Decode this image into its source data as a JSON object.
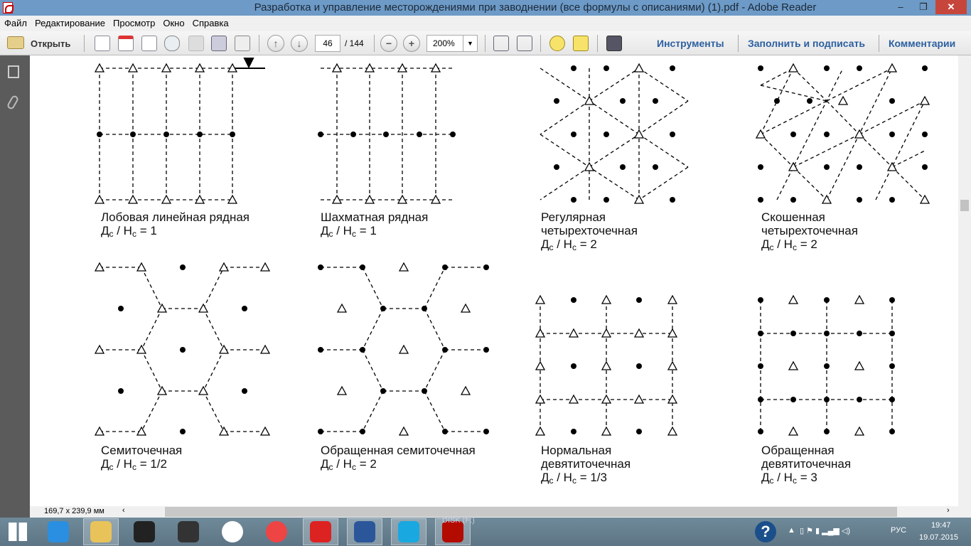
{
  "window": {
    "title": "Разработка и управление месторождениями при заводнении (все формулы с описаниями) (1).pdf - Adobe Reader",
    "minimize": "–",
    "restore": "❐",
    "close": "✕"
  },
  "menu": [
    "Файл",
    "Редактирование",
    "Просмотр",
    "Окно",
    "Справка"
  ],
  "toolbar": {
    "open": "Открыть",
    "page": "46",
    "page_total": "/ 144",
    "zoom": "200%",
    "tools": "Инструменты",
    "fill_sign": "Заполнить и подписать",
    "comments": "Комментарии"
  },
  "status": {
    "dimensions": "169,7 x 239,9 мм"
  },
  "diagrams": [
    {
      "name": "Лобовая линейная рядная",
      "lines": [],
      "f": {
        "a": "Д",
        "s1": "с",
        "b": " / Н",
        "s2": "с",
        "c": " = 1"
      }
    },
    {
      "name": "Шахматная рядная",
      "lines": [],
      "f": {
        "a": "Д",
        "s1": "с",
        "b": " / Н",
        "s2": "с",
        "c": " = 1"
      }
    },
    {
      "name": "Регулярная",
      "lines": [
        "четырехточечная"
      ],
      "f": {
        "a": "Д",
        "s1": "с",
        "b": " / Н",
        "s2": "с",
        "c": " = 2"
      }
    },
    {
      "name": "Скошенная",
      "lines": [
        "четырехточечная"
      ],
      "f": {
        "a": "Д",
        "s1": "с",
        "b": " / Н",
        "s2": "с",
        "c": " = 2"
      }
    },
    {
      "name": "Семиточечная",
      "lines": [],
      "f": {
        "a": "Д",
        "s1": "с",
        "b": " / Н",
        "s2": "с",
        "c": " = 1/2"
      }
    },
    {
      "name": "Обращенная семиточечная",
      "lines": [],
      "f": {
        "a": "Д",
        "s1": "с",
        "b": " / Н",
        "s2": "с",
        "c": " =  2"
      }
    },
    {
      "name": "Нормальная",
      "lines": [
        "девятиточечная"
      ],
      "f": {
        "a": "Д",
        "s1": "с",
        "b": " / Н",
        "s2": "с",
        "c": " = 1/3"
      }
    },
    {
      "name": "Обращенная",
      "lines": [
        "девятиточечная"
      ],
      "f": {
        "a": "Д",
        "s1": "с",
        "b": " / Н",
        "s2": "с",
        "c": " = 3"
      }
    }
  ],
  "taskbar": {
    "apps": [
      "internet-explorer",
      "file-explorer",
      "webcam",
      "paint-app",
      "hp",
      "chrome",
      "yandex-browser",
      "word",
      "skype",
      "adobe-reader"
    ],
    "drive_label": "DISK (F:)",
    "lang": "РУС",
    "time": "19:47",
    "date": "19.07.2015"
  }
}
